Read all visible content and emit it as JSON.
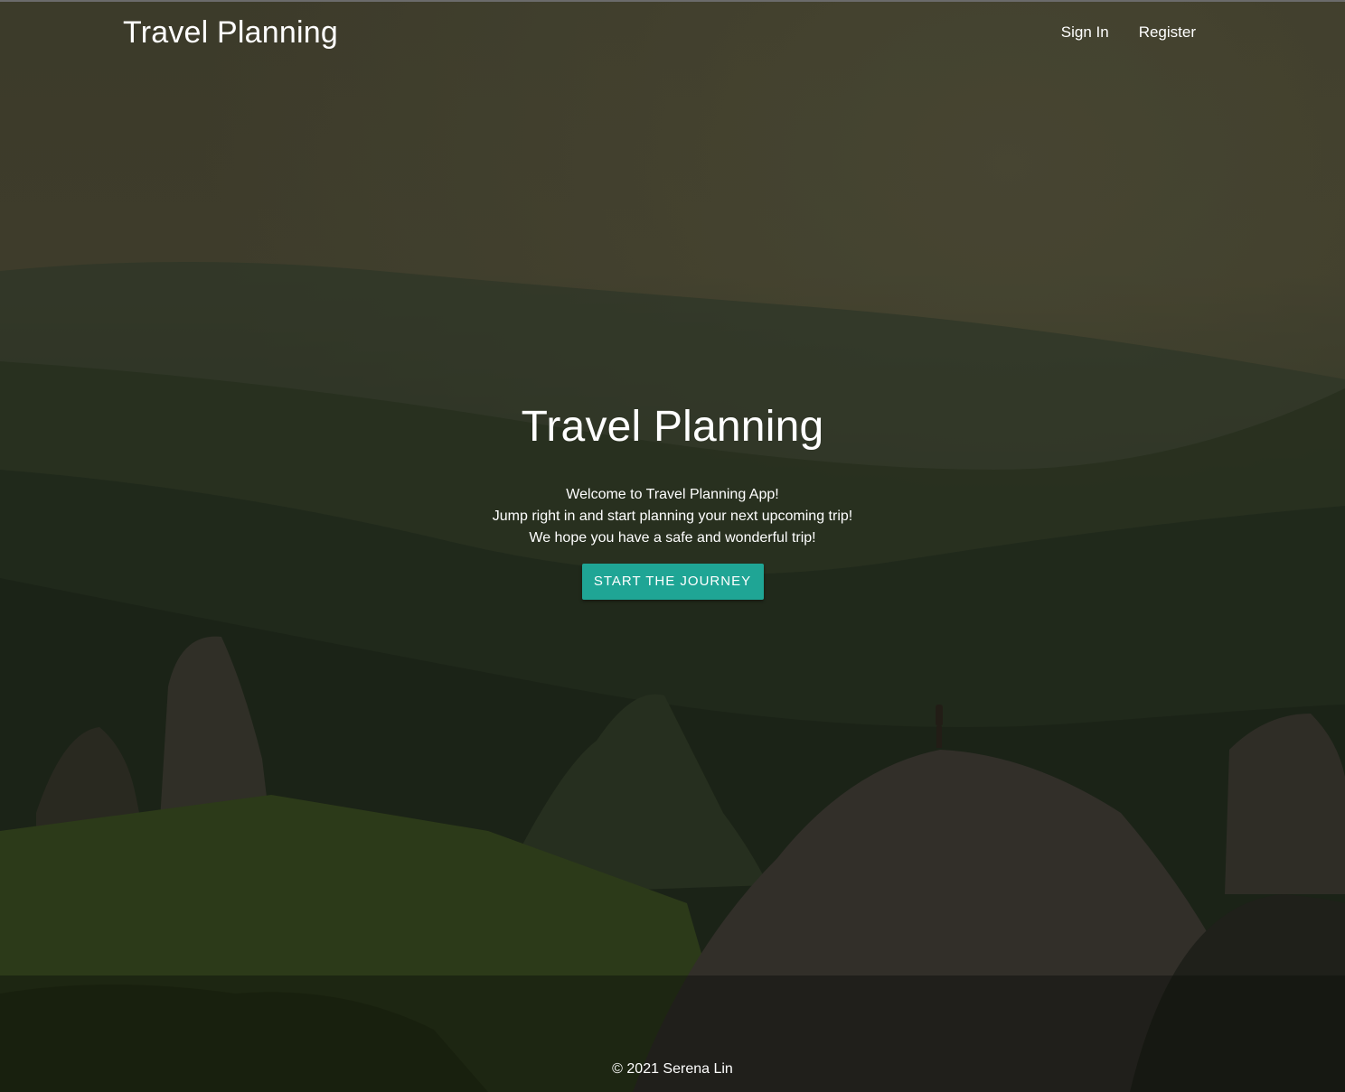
{
  "navbar": {
    "brand": "Travel Planning",
    "links": [
      {
        "label": "Sign In"
      },
      {
        "label": "Register"
      }
    ]
  },
  "hero": {
    "title": "Travel Planning",
    "lines": [
      "Welcome to Travel Planning App!",
      "Jump right in and start planning your next upcoming trip!",
      "We hope you have a safe and wonderful trip!"
    ],
    "cta_label": "Start the Journey"
  },
  "footer": {
    "copyright": "© 2021 Serena Lin"
  },
  "colors": {
    "cta_background": "#1fa595",
    "text": "#ffffff"
  },
  "background": {
    "image": "landscape-photo"
  }
}
